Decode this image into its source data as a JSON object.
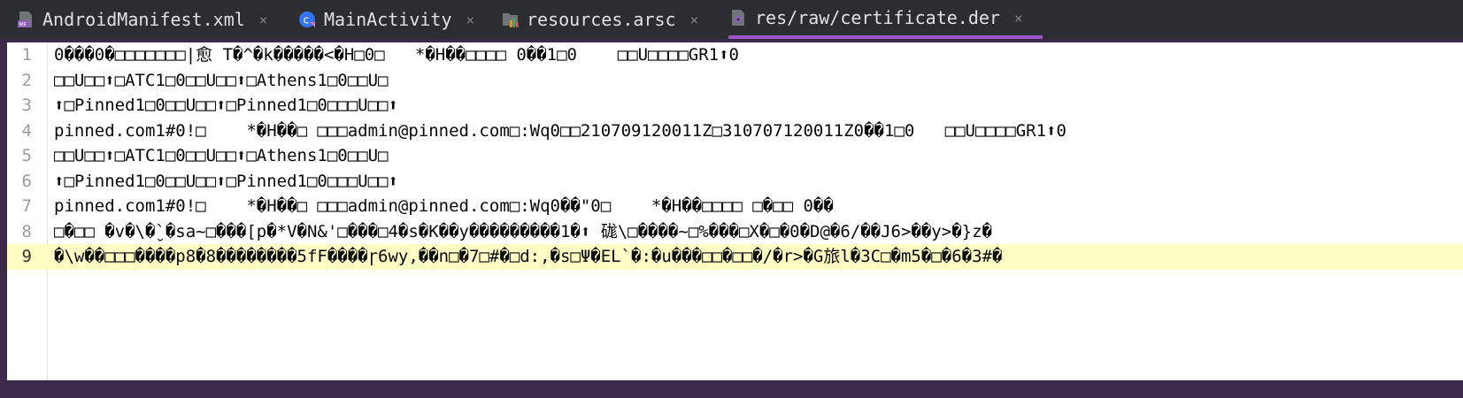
{
  "tabs": [
    {
      "label": "AndroidManifest.xml",
      "icon": "manifest-file-icon",
      "active": false
    },
    {
      "label": "MainActivity",
      "icon": "kotlin-class-icon",
      "active": false
    },
    {
      "label": "resources.arsc",
      "icon": "resources-file-icon",
      "active": false
    },
    {
      "label": "res/raw/certificate.der",
      "icon": "binary-file-icon",
      "active": true
    }
  ],
  "close_glyph": "×",
  "editor": {
    "current_line": 9,
    "lines": [
      {
        "num": "1",
        "text": "0���0�□□□□□□□|愈 T�^�k�����<�H□0□   *�H��□□□□ 0��1□0    □□U□□□□GR1⬆0"
      },
      {
        "num": "2",
        "text": "□□U□□⬆□ATC1□0□□U□□⬆□Athens1□0□□U□"
      },
      {
        "num": "3",
        "text": "⬆□Pinned1□0□□U□□⬆□Pinned1□0□□□U□□⬆"
      },
      {
        "num": "4",
        "text": "pinned.com1#0!□    *�H��□ □□□admin@pinned.com□:Wq0□□210709120011Z□310707120011Z0��1□0   □□U□□□□GR1⬆0"
      },
      {
        "num": "5",
        "text": "□□U□□⬆□ATC1□0□□U□□⬆□Athens1□0□□U□"
      },
      {
        "num": "6",
        "text": "⬆□Pinned1□0□□U□□⬆□Pinned1□0□□□U□□⬆"
      },
      {
        "num": "7",
        "text": "pinned.com1#0!□    *�H��□ □□□admin@pinned.com□:Wq0��\"0□    *�H��□□□□ □�□□ 0��"
      },
      {
        "num": "8",
        "text": "□�□□ �v�\\�̮`�sa~□���[p�*V�N&'□���□4�s�K��y���������1�⬆ 硥\\□����~□%���□X�□�0�D@�6/��J6>��y>�}z�"
      },
      {
        "num": "9",
        "text": "�\\w��□□□����p8�8��������5fF����ɼ6wy,��n□�7□#�□d:,�s□Ψ�EL`�:�u���□□�□□�/�r>�G旅l�3C□�m5�□�6�3#�"
      }
    ]
  },
  "colors": {
    "window_bg": "#3c2a4d",
    "tabbar_bg": "#2b2d30",
    "active_tab_underline": "#9b56c9",
    "editor_bg": "#ffffff",
    "current_line_bg": "#fdfdc4",
    "line_number": "#9c9c9c"
  }
}
